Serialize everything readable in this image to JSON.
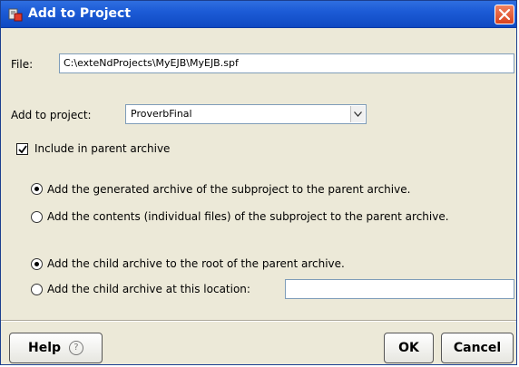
{
  "window": {
    "title": "Add to Project"
  },
  "file": {
    "label": "File:",
    "value": "C:\\exteNdProjects\\MyEJB\\MyEJB.spf"
  },
  "project": {
    "label": "Add to project:",
    "selected": "ProverbFinal"
  },
  "include_parent": {
    "label": "Include in parent archive",
    "checked": true
  },
  "archive_mode": {
    "options": [
      {
        "label": "Add the generated archive of the subproject to the parent archive.",
        "selected": true
      },
      {
        "label": "Add the contents (individual files) of the subproject to the parent archive.",
        "selected": false
      }
    ]
  },
  "location_mode": {
    "options": [
      {
        "label": "Add the child archive to the root of the parent archive.",
        "selected": true
      },
      {
        "label": "Add the child archive at this location:",
        "selected": false
      }
    ],
    "location_value": ""
  },
  "buttons": {
    "help": "Help",
    "ok": "OK",
    "cancel": "Cancel"
  },
  "colors": {
    "titlebar": "#1c5bd6",
    "close": "#d9421d",
    "dialog_bg": "#ece9d8"
  }
}
